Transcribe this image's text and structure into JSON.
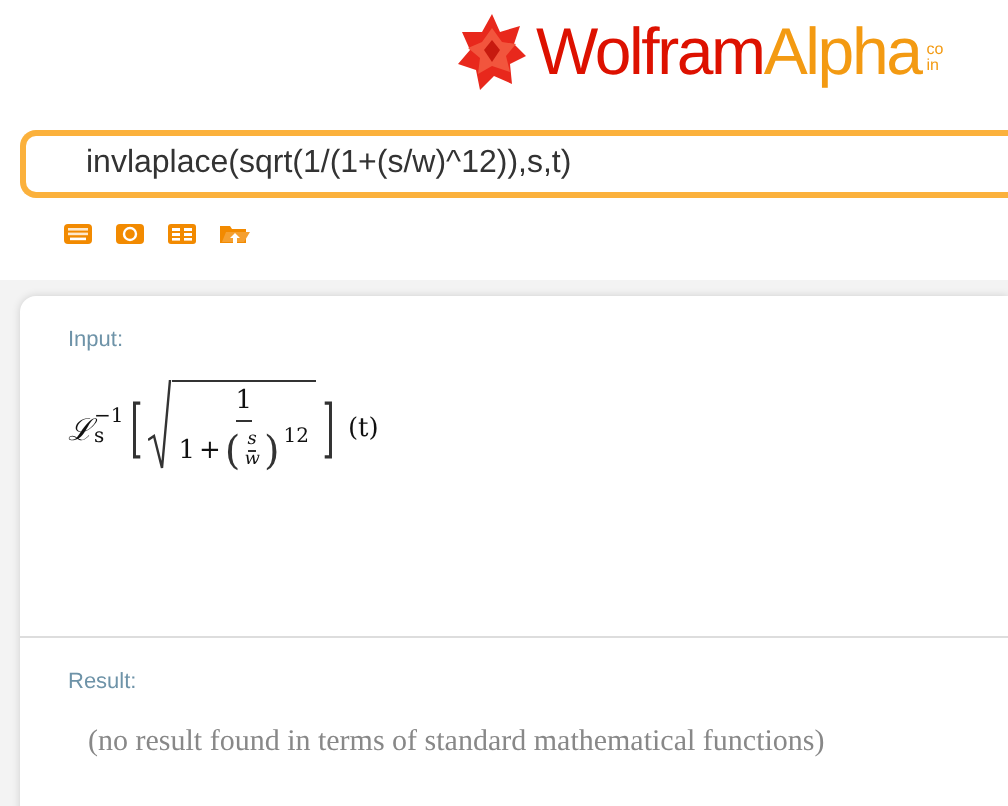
{
  "logo": {
    "word_1": "Wolfram",
    "word_2": "Alpha",
    "tagline_lines": [
      "co",
      "in"
    ]
  },
  "search": {
    "value": "invlaplace(sqrt(1/(1+(s/w)^12)),s,t)"
  },
  "input_tools": [
    {
      "kind": "keyboard"
    },
    {
      "kind": "camera"
    },
    {
      "kind": "table"
    },
    {
      "kind": "upload"
    }
  ],
  "pods": [
    {
      "title": "Input:",
      "kind": "formula",
      "formula": {
        "operator": "ℒ",
        "operator_sup": "−1",
        "operator_sub": "s",
        "open_bracket": "[",
        "numerator": "1",
        "denominator_one": "1",
        "plus": "+",
        "open_paren": "(",
        "inner_numerator": "s",
        "inner_denominator": "w",
        "close_paren": ")",
        "exponent": "12",
        "close_bracket": "]",
        "argument": "(t)"
      }
    },
    {
      "title": "Result:",
      "kind": "text",
      "text": "(no result found in terms of standard mathematical functions)"
    }
  ]
}
